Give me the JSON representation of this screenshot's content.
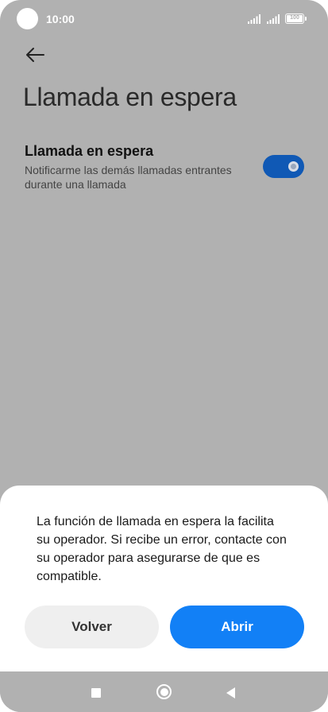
{
  "status_bar": {
    "time": "10:00",
    "battery_text": "100"
  },
  "header": {
    "title": "Llamada en espera"
  },
  "setting": {
    "title": "Llamada en espera",
    "description": "Notificarme las demás llamadas entrantes durante una llamada",
    "enabled": true
  },
  "dialog": {
    "message": "La función de llamada en espera la facilita su operador. Si recibe un error, contacte con su operador para asegurarse de que es compatible.",
    "back_label": "Volver",
    "open_label": "Abrir"
  },
  "colors": {
    "background": "#b1b1b1",
    "toggle_on": "#1059b5",
    "primary_button": "#1280f6",
    "secondary_button": "#efefef"
  },
  "icons": {
    "back": "arrow-left-icon",
    "nav_recents": "square-icon",
    "nav_home": "circle-icon",
    "nav_back": "triangle-left-icon"
  }
}
